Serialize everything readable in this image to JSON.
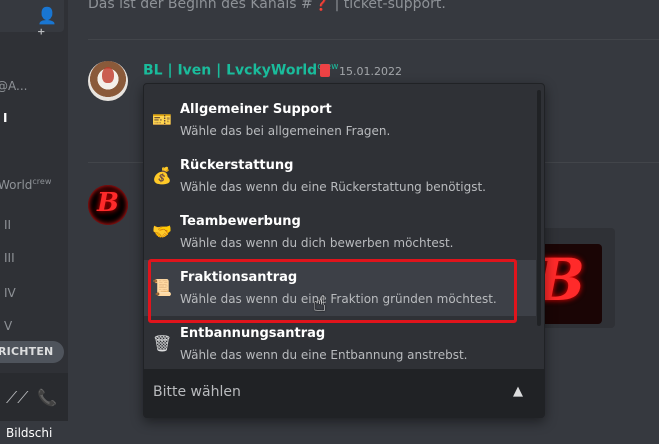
{
  "header": {
    "channel_intro": "Das ist der Beginn des Kanals #❓ | ticket-support."
  },
  "sidebar": {
    "items": [
      "@A...",
      "I",
      "World",
      "II",
      "III",
      "IV",
      "V"
    ],
    "world_sup": "crew",
    "pill_label": "RICHTEN",
    "footer_label": "Bildschi"
  },
  "message": {
    "author": "BL | Iven | LvckyWorld",
    "author_suffix": "crew",
    "timestamp": "15.01.2022"
  },
  "logo": {
    "letter": "B"
  },
  "dropdown": {
    "placeholder": "Bitte wählen",
    "options": [
      {
        "label": "Allgemeiner Support",
        "description": "Wähle das bei allgemeinen Fragen.",
        "icon": "ticket-icon",
        "glyph": "🎫"
      },
      {
        "label": "Rückerstattung",
        "description": "Wähle das wenn du eine Rückerstattung benötigst.",
        "icon": "money-bag-icon",
        "glyph": "💰"
      },
      {
        "label": "Teambewerbung",
        "description": "Wähle das wenn du dich bewerben möchtest.",
        "icon": "handshake-icon",
        "glyph": "🤝"
      },
      {
        "label": "Fraktionsantrag",
        "description": "Wähle das wenn du eine Fraktion gründen möchtest.",
        "icon": "scroll-icon",
        "glyph": "📜"
      },
      {
        "label": "Entbannungsantrag",
        "description": "Wähle das wenn du eine Entbannung anstrebst.",
        "icon": "trash-can-icon",
        "glyph": "🗑"
      }
    ]
  },
  "colors": {
    "author": "#1abc9c",
    "highlight_border": "#e0141c",
    "background": "#36393f"
  }
}
